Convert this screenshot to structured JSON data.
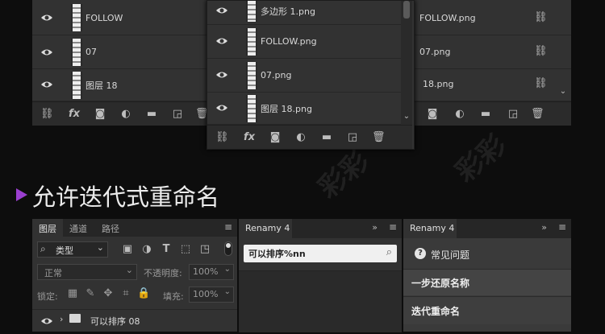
{
  "top": {
    "left_panel": {
      "layers": [
        {
          "name": "FOLLOW"
        },
        {
          "name": "07"
        },
        {
          "name": "图层 18"
        }
      ]
    },
    "middle_panel": {
      "layers": [
        {
          "name": "多边形 1.png"
        },
        {
          "name": "FOLLOW.png"
        },
        {
          "name": "07.png"
        },
        {
          "name": "图层 18.png"
        }
      ]
    },
    "right_panel": {
      "layers": [
        {
          "name": "FOLLOW.png"
        },
        {
          "name": "07.png"
        },
        {
          "name": "18.png"
        }
      ]
    },
    "toolbar_icons": [
      "link-icon",
      "fx-icon",
      "mask-icon",
      "adjustment-icon",
      "folder-icon",
      "new-layer-icon",
      "trash-icon"
    ]
  },
  "heading": {
    "text": "允许迭代式重命名",
    "accent": "#9b3fd0"
  },
  "bottom": {
    "layers_panel": {
      "tabs": [
        "图层",
        "通道",
        "路径"
      ],
      "filter_label": "类型",
      "blend_mode": "正常",
      "opacity_label": "不透明度:",
      "opacity_value": "100%",
      "lock_label": "锁定:",
      "fill_label": "填充:",
      "fill_value": "100%",
      "layer_name": "可以排序 08"
    },
    "renamy_middle": {
      "title": "Renamy 4",
      "input_value": "可以排序%nn"
    },
    "renamy_right": {
      "title": "Renamy 4",
      "faq_label": "常见问题",
      "items": [
        "一步还原名称",
        "迭代重命名"
      ]
    }
  }
}
